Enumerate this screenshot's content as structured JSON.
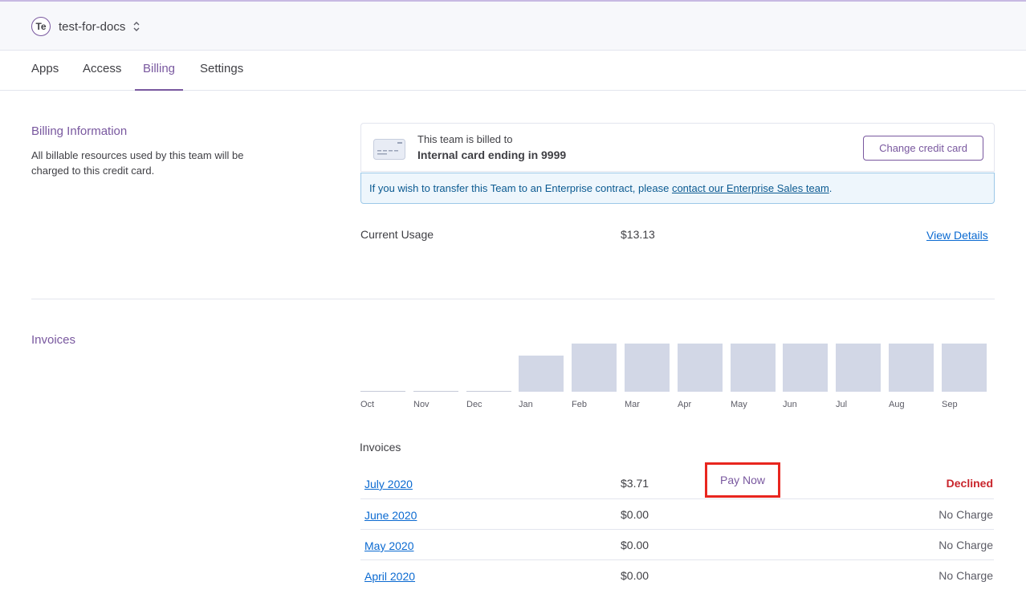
{
  "header": {
    "team_avatar": "Te",
    "team_name": "test-for-docs",
    "chevron_icon": "chevron-up-down-icon"
  },
  "tabs": [
    {
      "label": "Apps"
    },
    {
      "label": "Access"
    },
    {
      "label": "Billing",
      "active": true
    },
    {
      "label": "Settings"
    }
  ],
  "billing": {
    "title": "Billing Information",
    "description": "All billable resources used by this team will be charged to this credit card.",
    "billed_to_label": "This team is billed to",
    "card_name": "Internal card ending in 9999",
    "card_icon": "credit-card-icon",
    "change_button": "Change credit card",
    "notice_prefix": "If you wish to transfer this Team to an Enterprise contract, please ",
    "notice_link": "contact our Enterprise Sales team",
    "notice_suffix": ".",
    "usage_label": "Current Usage",
    "usage_value": "$13.13",
    "view_details": "View Details"
  },
  "invoices": {
    "section_title": "Invoices",
    "list_heading": "Invoices",
    "rows": [
      {
        "month": "July 2020",
        "amount": "$3.71",
        "action": "Pay Now",
        "status": "Declined",
        "declined": true
      },
      {
        "month": "June 2020",
        "amount": "$0.00",
        "status": "No Charge"
      },
      {
        "month": "May 2020",
        "amount": "$0.00",
        "status": "No Charge"
      },
      {
        "month": "April 2020",
        "amount": "$0.00",
        "status": "No Charge"
      }
    ]
  },
  "chart_data": {
    "type": "bar",
    "categories": [
      "Oct",
      "Nov",
      "Dec",
      "Jan",
      "Feb",
      "Mar",
      "Apr",
      "May",
      "Jun",
      "Jul",
      "Aug",
      "Sep"
    ],
    "values": [
      0,
      0,
      0,
      0.75,
      1,
      1,
      1,
      1,
      1,
      1,
      1,
      1
    ],
    "bar_color": "#d2d7e6"
  },
  "colors": {
    "accent": "#79589f",
    "link": "#0b6ad1",
    "declined": "#c9252c",
    "highlight": "#e8261f"
  }
}
